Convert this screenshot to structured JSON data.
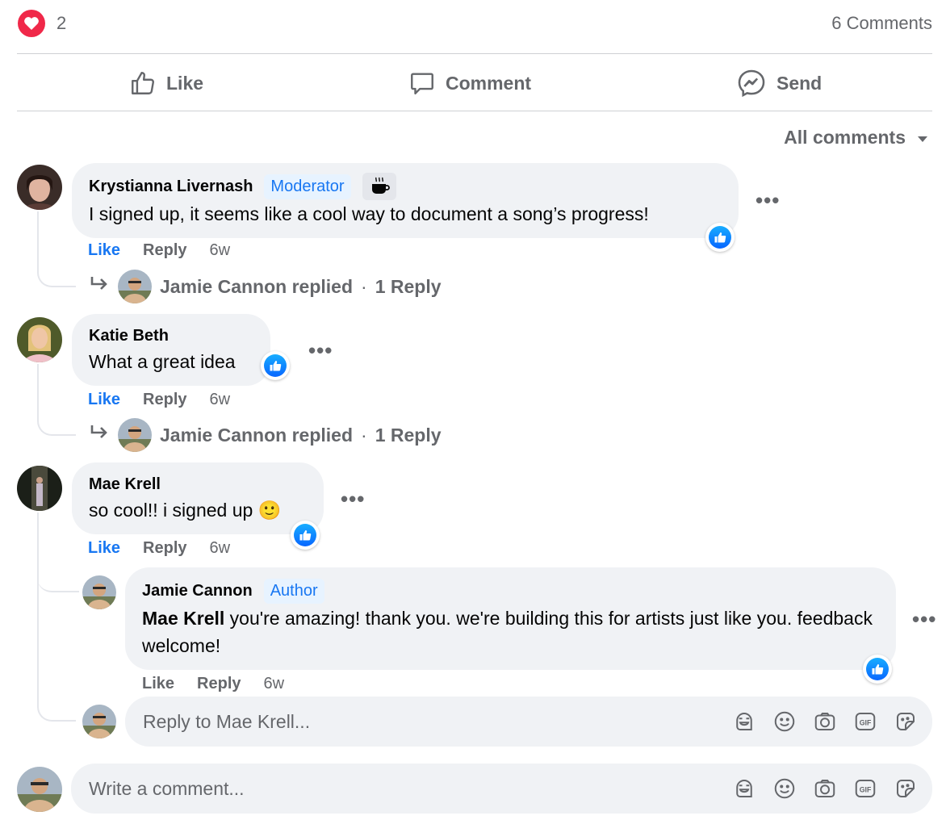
{
  "summary": {
    "reaction_count": "2",
    "comments_label": "6 Comments"
  },
  "actions": {
    "like": "Like",
    "comment": "Comment",
    "send": "Send"
  },
  "filter": {
    "label": "All comments"
  },
  "comments": [
    {
      "author": "Krystianna Livernash",
      "badge": "Moderator",
      "text": "I signed up, it seems like a cool way to document a song’s progress!",
      "like": "Like",
      "reply": "Reply",
      "time": "6w",
      "replies": {
        "replier": "Jamie Cannon replied",
        "separator": "·",
        "count": "1 Reply"
      }
    },
    {
      "author": "Katie Beth",
      "text": "What a great idea",
      "like": "Like",
      "reply": "Reply",
      "time": "6w",
      "replies": {
        "replier": "Jamie Cannon replied",
        "separator": "·",
        "count": "1 Reply"
      }
    },
    {
      "author": "Mae Krell",
      "text": "so cool!! i signed up",
      "emoji": "🙂",
      "like": "Like",
      "reply": "Reply",
      "time": "6w",
      "nested": {
        "author": "Jamie Cannon",
        "badge": "Author",
        "mention": "Mae Krell",
        "text": " you're amazing! thank you. we're building this for artists just like you. feedback welcome!",
        "like": "Like",
        "reply": "Reply",
        "time": "6w"
      }
    }
  ],
  "reply_input": {
    "placeholder": "Reply to Mae Krell..."
  },
  "comment_input": {
    "placeholder": "Write a comment..."
  },
  "colors": {
    "accent": "#1877f2",
    "heart": "#f02849",
    "bubble": "#f0f2f5",
    "muted": "#65676b"
  }
}
